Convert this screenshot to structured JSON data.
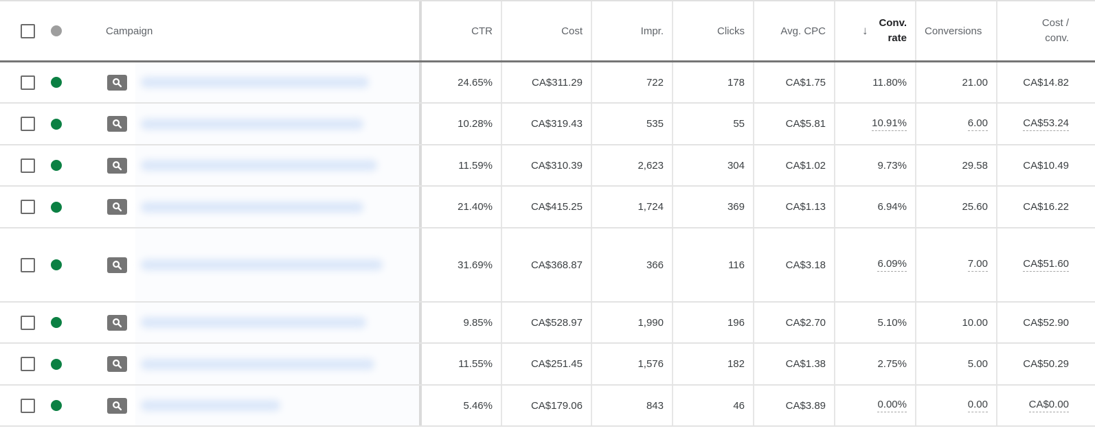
{
  "header": {
    "campaign": "Campaign",
    "ctr": "CTR",
    "cost": "Cost",
    "impr": "Impr.",
    "clicks": "Clicks",
    "avg_cpc": "Avg. CPC",
    "conv_rate_line1": "Conv.",
    "conv_rate_line2": "rate",
    "conversions": "Conversions",
    "cost_conv_line1": "Cost /",
    "cost_conv_line2": "conv.",
    "sort_icon": "arrow-down-icon",
    "sorted_column": "Conv. rate",
    "sort_direction": "descending"
  },
  "colors": {
    "status_enabled": "#0b8043",
    "status_header": "#9e9e9e",
    "search_badge": "#757575"
  },
  "rows": [
    {
      "status": "enabled",
      "campaign_type_icon": "search-icon",
      "campaign_name": "[blurred]",
      "ctr": "24.65%",
      "cost": "CA$311.29",
      "impr": "722",
      "clicks": "178",
      "avg_cpc": "CA$1.75",
      "conv_rate": "11.80%",
      "conversions": "21.00",
      "cost_conv": "CA$14.82",
      "dashed": false
    },
    {
      "status": "enabled",
      "campaign_type_icon": "search-icon",
      "campaign_name": "[blurred]",
      "ctr": "10.28%",
      "cost": "CA$319.43",
      "impr": "535",
      "clicks": "55",
      "avg_cpc": "CA$5.81",
      "conv_rate": "10.91%",
      "conversions": "6.00",
      "cost_conv": "CA$53.24",
      "dashed": true
    },
    {
      "status": "enabled",
      "campaign_type_icon": "search-icon",
      "campaign_name": "[blurred]",
      "ctr": "11.59%",
      "cost": "CA$310.39",
      "impr": "2,623",
      "clicks": "304",
      "avg_cpc": "CA$1.02",
      "conv_rate": "9.73%",
      "conversions": "29.58",
      "cost_conv": "CA$10.49",
      "dashed": false
    },
    {
      "status": "enabled",
      "campaign_type_icon": "search-icon",
      "campaign_name": "[blurred]",
      "ctr": "21.40%",
      "cost": "CA$415.25",
      "impr": "1,724",
      "clicks": "369",
      "avg_cpc": "CA$1.13",
      "conv_rate": "6.94%",
      "conversions": "25.60",
      "cost_conv": "CA$16.22",
      "dashed": false
    },
    {
      "status": "enabled",
      "campaign_type_icon": "search-icon",
      "campaign_name": "[blurred]",
      "ctr": "31.69%",
      "cost": "CA$368.87",
      "impr": "366",
      "clicks": "116",
      "avg_cpc": "CA$3.18",
      "conv_rate": "6.09%",
      "conversions": "7.00",
      "cost_conv": "CA$51.60",
      "dashed": true
    },
    {
      "status": "enabled",
      "campaign_type_icon": "search-icon",
      "campaign_name": "[blurred]",
      "ctr": "9.85%",
      "cost": "CA$528.97",
      "impr": "1,990",
      "clicks": "196",
      "avg_cpc": "CA$2.70",
      "conv_rate": "5.10%",
      "conversions": "10.00",
      "cost_conv": "CA$52.90",
      "dashed": false
    },
    {
      "status": "enabled",
      "campaign_type_icon": "search-icon",
      "campaign_name": "[blurred]",
      "ctr": "11.55%",
      "cost": "CA$251.45",
      "impr": "1,576",
      "clicks": "182",
      "avg_cpc": "CA$1.38",
      "conv_rate": "2.75%",
      "conversions": "5.00",
      "cost_conv": "CA$50.29",
      "dashed": false
    },
    {
      "status": "enabled",
      "campaign_type_icon": "search-icon",
      "campaign_name": "[blurred]",
      "ctr": "5.46%",
      "cost": "CA$179.06",
      "impr": "843",
      "clicks": "46",
      "avg_cpc": "CA$3.89",
      "conv_rate": "0.00%",
      "conversions": "0.00",
      "cost_conv": "CA$0.00",
      "dashed": true
    }
  ]
}
